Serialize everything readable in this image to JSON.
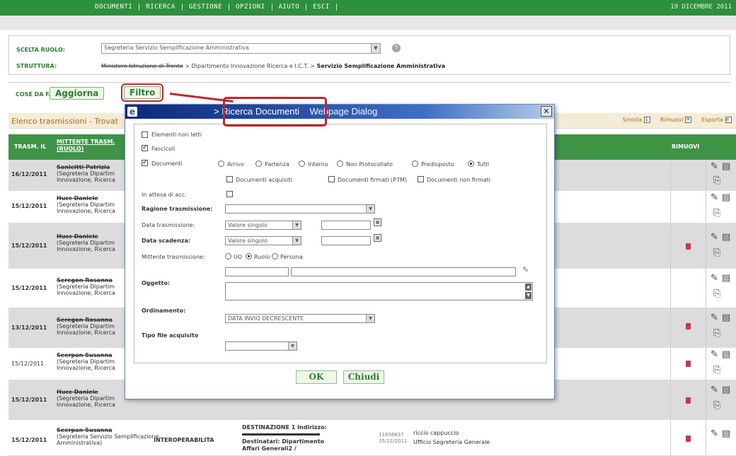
{
  "menu": {
    "items": [
      "DOCUMENTI",
      "RICERCA",
      "GESTIONE",
      "OPZIONI",
      "AIUTO",
      "ESCI"
    ],
    "date": "19 DICEMBRE 2011"
  },
  "role": {
    "label": "SCELTA RUOLO:",
    "value": "Segreteria Servizio Semplificazione Amministrativa",
    "help_icon": "help-icon",
    "struttura_label": "STRUTTURA:",
    "struttura_strike": "Ministero Istruzione di Trento",
    "struttura_path": "> Dipartimento Innovazione Ricerca e I.C.T. >",
    "struttura_end": "Servizio Semplificazione Amministrativa"
  },
  "cose": {
    "label": "COSE DA FARE",
    "aggiorna": "Aggiorna",
    "filtro": "Filtro"
  },
  "list": {
    "title": "Elenco trasmissioni - Trovat",
    "smista": "Smista",
    "rimuovi": "Rimuovi",
    "esporta": "Esporta"
  },
  "table": {
    "col_date": "TRASM. IL",
    "col_sender": "MITTENTE TRASM. (RUOLO)",
    "col_rimuovi": "RIMUOVI",
    "rows": [
      {
        "date": "16/12/2011",
        "name": "Sanleitti Patrizia",
        "dept": "(Segreteria Dipartim",
        "sub": "Innovazione, Ricerca"
      },
      {
        "date": "15/12/2011",
        "name": "Hucc Daniele",
        "dept": "(Segreteria Dipartim",
        "sub": "Innovazione, Ricerca"
      },
      {
        "date": "15/12/2011",
        "name": "Hucc Daniele",
        "dept": "(Segreteria Dipartim",
        "sub": "Innovazione, Ricerca"
      },
      {
        "date": "15/12/2011",
        "name": "Seregon Rosanna",
        "dept": "(Segreteria Dipartim",
        "sub": "Innovazione, Ricerca"
      },
      {
        "date": "13/12/2011",
        "name": "Seregon Rosanna",
        "dept": "(Segreteria Dipartim",
        "sub": "Innovazione, Ricerca"
      },
      {
        "date": "15/12/2011",
        "name": "Seerpan Susanna",
        "dept": "(Segreteria Dipartim",
        "sub": "Innovazione, Ricerca"
      },
      {
        "date": "15/12/2011",
        "name": "Hucc Daniele",
        "dept": "(Segreteria Dipartim",
        "sub": "Innovazione, Ricerca"
      }
    ],
    "last_row": {
      "date": "15/12/2011",
      "name": "Seerpan Susanna",
      "dept": "(Segreteria Servizio Semplificazione",
      "sub": "Amministrativa)",
      "type": "INTEROPERABILITA",
      "dest1": "DESTINAZIONE 1 Indirizzo:",
      "dest2": "Destinatari: Dipartimento",
      "dest3": "Affari Generali2 /",
      "proto1": "11836837",
      "proto2": "15/12/2011",
      "obj1": "riccio cappuccio",
      "obj2": "Ufficio Segreteria Generale"
    }
  },
  "dialog": {
    "title_main": "> Ricerca Documenti",
    "title_suffix": "Webpage Dialog",
    "close": "✕",
    "elementi_non_letti": "Elementi non letti",
    "fascicoli": "Fascicoli",
    "documenti": "Documenti",
    "radio_arrivo": "Arrivo",
    "radio_partenza": "Partenza",
    "radio_interno": "Interno",
    "radio_non_protocollato": "Non Protocollato",
    "radio_predisposto": "Predisposto",
    "radio_tutti": "Tutti",
    "doc_acquisiti": "Documenti acquisiti",
    "doc_firmati": "Documenti firmati (P7M)",
    "doc_non_firmati": "Documenti non firmati",
    "in_attesa": "In attesa di acc.",
    "ragione_label": "Ragione trasmissione:",
    "data_trasm_label": "Data trasmissione:",
    "data_trasm_value": "Valore singolo",
    "data_scad_label": "Data scadenza:",
    "data_scad_value": "Valore singolo",
    "mittente_label": "Mittente trasmissione:",
    "radio_uo": "UO",
    "radio_ruolo": "Ruolo",
    "radio_persona": "Persona",
    "oggetto_label": "Oggetto:",
    "ordinamento_label": "Ordinamento:",
    "ordinamento_value": "DATA INVIO DECRESCENTE",
    "tipo_file_label": "Tipo file acquisito",
    "ok": "OK",
    "chiudi": "Chiudi"
  }
}
